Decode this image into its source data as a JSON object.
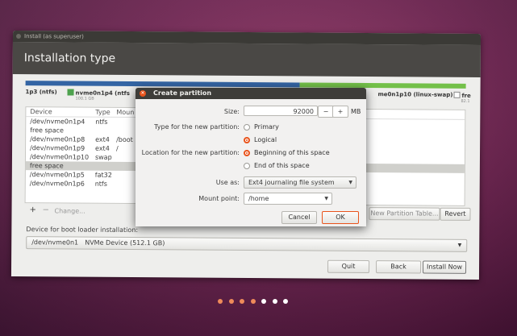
{
  "window": {
    "titlebar": "Install (as superuser)",
    "header": "Installation type"
  },
  "disk": {
    "legend": [
      {
        "label": "1p3 (ntfs)",
        "sub": "",
        "color": ""
      },
      {
        "label": "nvme0n1p4 (ntfs",
        "sub": "100.1 GB",
        "color": "#4ea24e"
      },
      {
        "label": "me0n1p10 (linux-swap)",
        "sub": "",
        "color": ""
      },
      {
        "label": "fre",
        "sub": "82.1",
        "color": "#ffffff"
      }
    ],
    "segment_colors": [
      "#3465a4",
      "#73c049"
    ]
  },
  "table": {
    "headers": [
      "Device",
      "Type",
      "Moun"
    ],
    "rows": [
      {
        "device": "/dev/nvme0n1p4",
        "type": "ntfs",
        "mount": "",
        "selected": false
      },
      {
        "device": "free space",
        "type": "",
        "mount": "",
        "selected": false
      },
      {
        "device": "/dev/nvme0n1p8",
        "type": "ext4",
        "mount": "/boot",
        "selected": false
      },
      {
        "device": "/dev/nvme0n1p9",
        "type": "ext4",
        "mount": "/",
        "selected": false
      },
      {
        "device": "/dev/nvme0n1p10",
        "type": "swap",
        "mount": "",
        "selected": false
      },
      {
        "device": "free space",
        "type": "",
        "mount": "",
        "selected": true
      },
      {
        "device": "/dev/nvme0n1p5",
        "type": "fat32",
        "mount": "",
        "selected": false
      },
      {
        "device": "/dev/nvme0n1p6",
        "type": "ntfs",
        "mount": "",
        "selected": false
      }
    ],
    "add": "+",
    "remove": "−",
    "change": "Change...",
    "new_table": "New Partition Table...",
    "revert": "Revert"
  },
  "boot": {
    "label": "Device for boot loader installation:",
    "device": "/dev/nvme0n1",
    "description": "NVMe Device (512.1 GB)"
  },
  "footer": {
    "quit": "Quit",
    "back": "Back",
    "install": "Install Now"
  },
  "dialog": {
    "title": "Create partition",
    "size_label": "Size:",
    "size_value": "92000",
    "size_minus": "−",
    "size_plus": "+",
    "size_unit": "MB",
    "type_label": "Type for the new partition:",
    "type_primary": "Primary",
    "type_logical": "Logical",
    "location_label": "Location for the new partition:",
    "location_begin": "Beginning of this space",
    "location_end": "End of this space",
    "useas_label": "Use as:",
    "useas_value": "Ext4 journaling file system",
    "mount_label": "Mount point:",
    "mount_value": "/home",
    "cancel": "Cancel",
    "ok": "OK"
  },
  "colors": {
    "accent": "#e9541c",
    "progress_active": "#ef8b5a",
    "progress_inactive": "#ffffff"
  },
  "progress": {
    "total_steps": 7,
    "completed_steps": 4
  }
}
